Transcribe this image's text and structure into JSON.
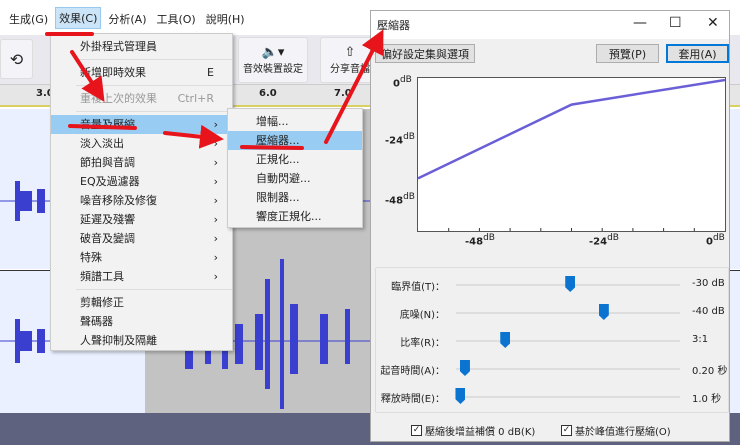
{
  "menubar": {
    "items": [
      "生成(G)",
      "效果(C)",
      "分析(A)",
      "工具(O)",
      "說明(H)"
    ],
    "active": 1
  },
  "toolbar": {
    "audio_setup": "音效裝置設定",
    "share_audio": "分享音檔"
  },
  "ruler": {
    "ticks": [
      "3.0",
      "6.0",
      "7.0"
    ]
  },
  "effects_menu": {
    "items": [
      {
        "label": "外掛程式管理員"
      },
      {
        "label": "新增即時效果",
        "shortcut": "E"
      },
      {
        "label": "重複上次的效果",
        "shortcut": "Ctrl+R",
        "disabled": true
      },
      {
        "label": "音量及壓縮",
        "submenu": true,
        "highlighted": true
      },
      {
        "label": "淡入淡出",
        "submenu": true
      },
      {
        "label": "節拍與音調",
        "submenu": true
      },
      {
        "label": "EQ及過濾器",
        "submenu": true
      },
      {
        "label": "噪音移除及修復",
        "submenu": true
      },
      {
        "label": "延遲及殘響",
        "submenu": true
      },
      {
        "label": "破音及變調",
        "submenu": true
      },
      {
        "label": "特殊",
        "submenu": true
      },
      {
        "label": "頻譜工具",
        "submenu": true
      },
      {
        "label": "剪輯修正"
      },
      {
        "label": "聲碼器"
      },
      {
        "label": "人聲抑制及隔離"
      }
    ]
  },
  "volume_submenu": {
    "items": [
      "增幅...",
      "壓縮器...",
      "正規化...",
      "自動閃避...",
      "限制器...",
      "響度正規化..."
    ],
    "highlighted": 1
  },
  "dialog": {
    "title": "壓縮器",
    "presets_button": "偏好設定集與選項",
    "preview_button": "預覽(P)",
    "apply_button": "套用(A)",
    "graph": {
      "y_ticks": [
        "0",
        "-24",
        "-48"
      ],
      "x_ticks": [
        "-48",
        "-24",
        "0"
      ],
      "unit": "dB",
      "curve": [
        {
          "in": -60,
          "out": -40
        },
        {
          "in": -30,
          "out": -10
        },
        {
          "in": 0,
          "out": 0
        }
      ],
      "range": [
        -60,
        0
      ],
      "line_color": "#6b5fd8"
    },
    "sliders": [
      {
        "label": "臨界值(T)：",
        "value": "-30 dB",
        "position": 0.51
      },
      {
        "label": "底噪(N)：",
        "value": "-40 dB",
        "position": 0.66
      },
      {
        "label": "比率(R)：",
        "value": "3:1",
        "position": 0.22
      },
      {
        "label": "起音時間(A)：",
        "value": "0.20 秒",
        "position": 0.04
      },
      {
        "label": "釋放時間(E)：",
        "value": "1.0 秒",
        "position": 0.02
      }
    ],
    "checkboxes": [
      {
        "label": "壓縮後增益補償 0 dB(K)",
        "checked": true
      },
      {
        "label": "基於峰值進行壓縮(O)",
        "checked": true
      }
    ],
    "checkmark": "✓"
  },
  "colors": {
    "annotation": "#e8141b",
    "wave": "#3b3fcf",
    "highlight": "#99ccf2"
  }
}
